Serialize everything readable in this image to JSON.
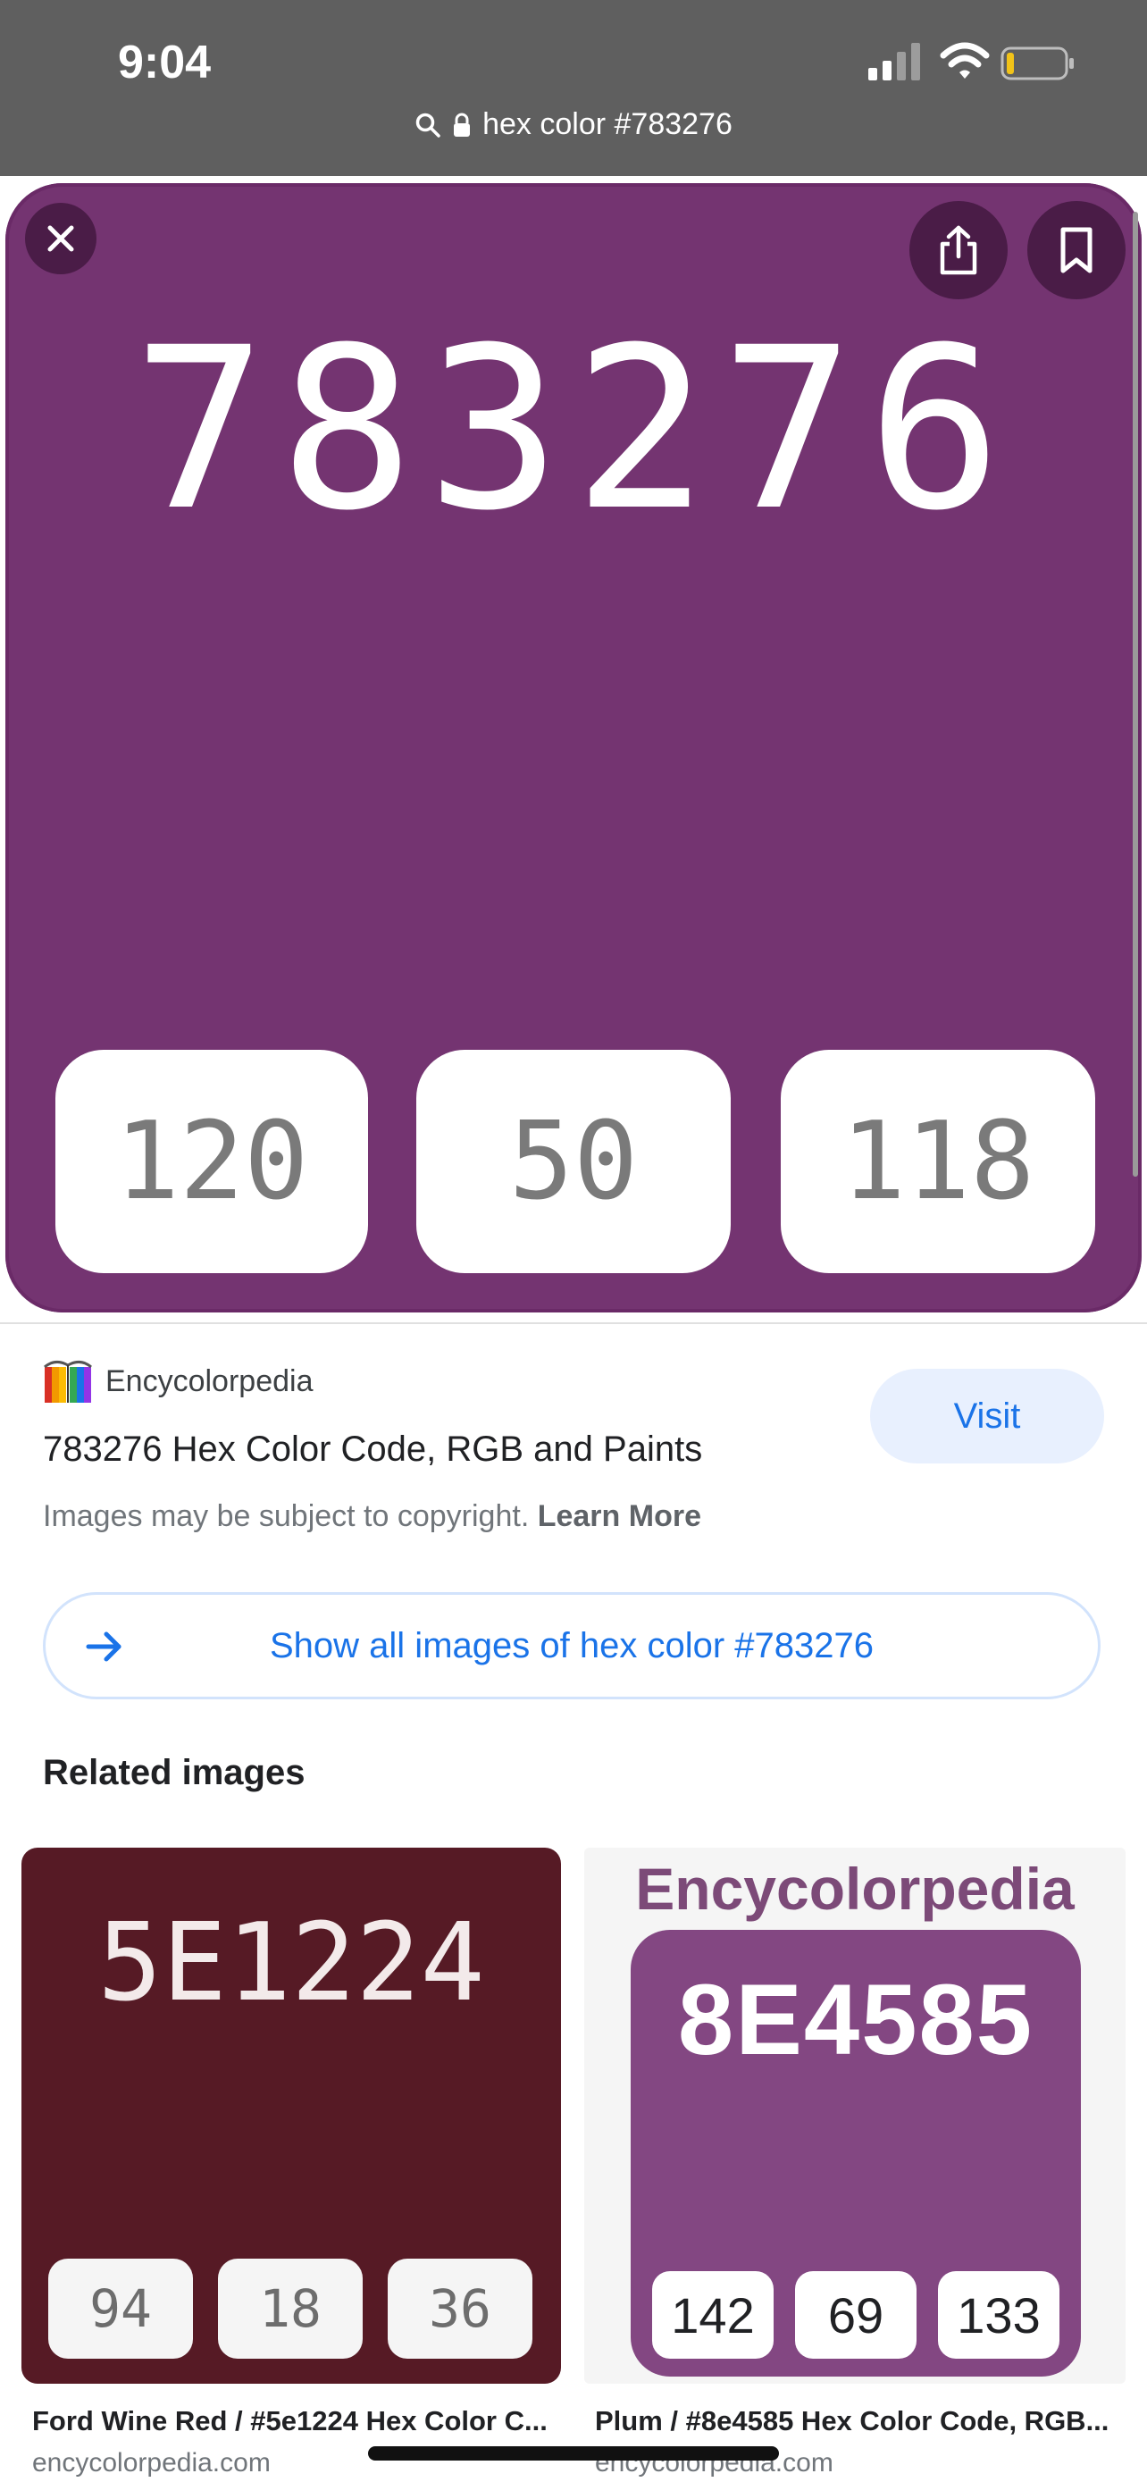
{
  "status_bar": {
    "time": "9:04"
  },
  "url_bar": {
    "text": "hex color #783276"
  },
  "hero": {
    "hex": "783276",
    "rgb": [
      "120",
      "50",
      "118"
    ],
    "color": "#743471"
  },
  "source": {
    "site_name": "Encycolorpedia",
    "title": "783276 Hex Color Code, RGB and Paints",
    "copyright_text": "Images may be subject to copyright.",
    "learn_more": "Learn More",
    "visit_label": "Visit"
  },
  "show_all_label": "Show all images of hex color #783276",
  "related": {
    "heading": "Related images",
    "items": [
      {
        "hex": "5E1224",
        "rgb": [
          "94",
          "18",
          "36"
        ],
        "caption": "Ford Wine Red / #5e1224 Hex Color C...",
        "domain": "encycolorpedia.com",
        "color": "#561a25"
      },
      {
        "brand": "Encycolorpedia",
        "hex": "8E4585",
        "rgb": [
          "142",
          "69",
          "133"
        ],
        "caption": "Plum / #8e4585 Hex Color Code, RGB...",
        "domain": "encycolorpedia.com",
        "color": "#834782"
      }
    ]
  },
  "colors": {
    "accent": "#1a73e8",
    "topbar": "#5f5f5f"
  }
}
